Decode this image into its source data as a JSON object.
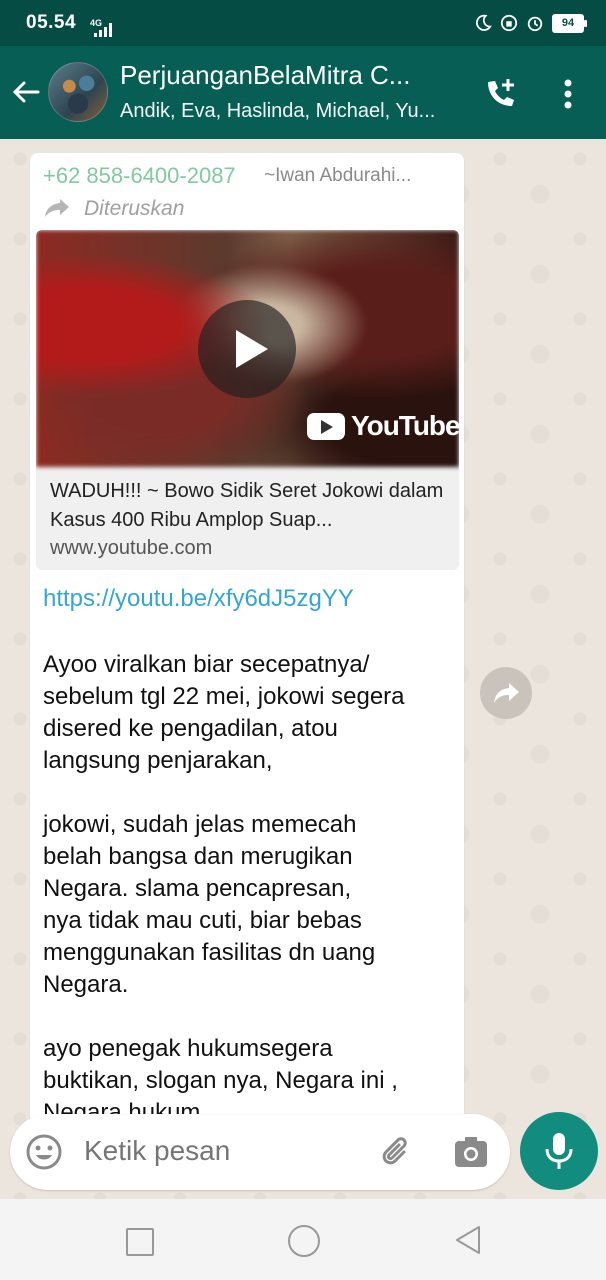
{
  "status_bar": {
    "time": "05.54",
    "network": "4G",
    "battery": "94"
  },
  "header": {
    "title": "PerjuanganBelaMitra C...",
    "subtitle": "Andik, Eva, Haslinda, Michael, Yu..."
  },
  "message": {
    "sender_phone": "+62 858-6400-2087",
    "sender_name": "~Iwan Abdurahi...",
    "forwarded_label": "Diteruskan",
    "preview": {
      "brand": "YouTube",
      "title": "WADUH!!! ~ Bowo Sidik Seret Jokowi dalam Kasus 400 Ribu Amplop Suap...",
      "domain": "www.youtube.com"
    },
    "link": "https://youtu.be/xfy6dJ5zgYY",
    "body": "Ayoo viralkan biar secepatnya/\nsebelum tgl 22 mei, jokowi segera\ndisered ke pengadilan, atou\nlangsung penjarakan,\n\njokowi, sudah jelas memecah\nbelah bangsa dan merugikan\nNegara. slama pencapresan,\nnya tidak mau cuti, biar bebas\nmenggunakan fasilitas dn uang\nNegara.\n\nayo penegak hukumsegera\nbuktikan, slogan nya, Negara ini ,\nNegara hukum..."
  },
  "composer": {
    "placeholder": "Ketik pesan"
  },
  "colors": {
    "header": "#075e54",
    "status": "#054d44",
    "accent": "#128c7e",
    "link": "#34a6d4"
  }
}
